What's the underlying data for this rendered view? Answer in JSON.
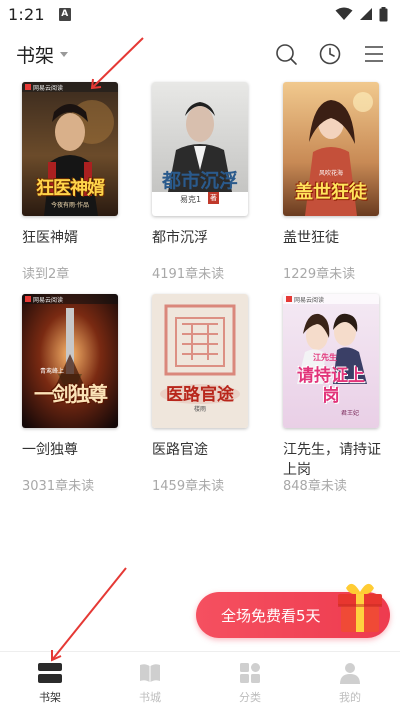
{
  "status_bar": {
    "time": "1:21",
    "notice_icon": "A"
  },
  "header": {
    "title": "书架"
  },
  "books": [
    {
      "title": "狂医神婿",
      "status": "读到2章",
      "cover_text": "狂医神婿",
      "cover_author": "今夜有雨·作品",
      "cover_badge": "网易云阅读"
    },
    {
      "title": "都市沉浮",
      "status": "4191章未读",
      "cover_text": "都市沉浮",
      "cover_author": "易克1",
      "cover_author_tag": "著"
    },
    {
      "title": "盖世狂徒",
      "status": "1229章未读",
      "cover_text": "盖世狂徒",
      "cover_author": "风吹花海"
    },
    {
      "title": "一剑独尊",
      "status": "3031章未读",
      "cover_text": "一剑独尊",
      "cover_author": "青鸾峰上",
      "cover_badge": "网易云阅读"
    },
    {
      "title": "医路官途",
      "status": "1459章未读",
      "cover_text": "医路官途",
      "cover_author": "楼雨"
    },
    {
      "title": "江先生，请持证上岗",
      "status": "848章未读",
      "cover_text_top": "江先生",
      "cover_text": "请持证上岗",
      "cover_author": "君王妃",
      "cover_badge": "网易云阅读"
    }
  ],
  "promo": {
    "label": "全场免费看5天"
  },
  "tabs": [
    {
      "label": "书架",
      "active": true
    },
    {
      "label": "书城",
      "active": false
    },
    {
      "label": "分类",
      "active": false
    },
    {
      "label": "我的",
      "active": false
    }
  ],
  "colors": {
    "accent": "#ee3b4f",
    "annotation_arrow": "#e53935"
  }
}
